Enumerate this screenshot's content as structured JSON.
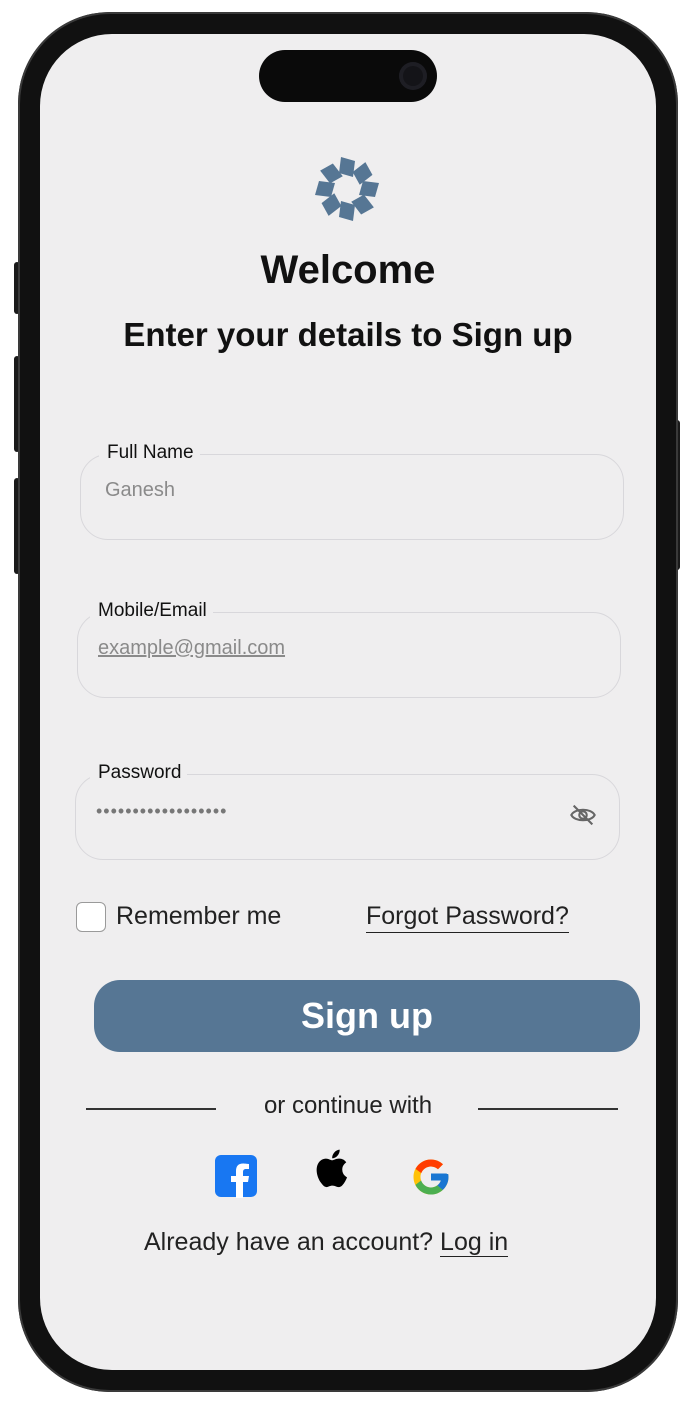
{
  "header": {
    "title": "Welcome",
    "subtitle": "Enter your details to Sign up"
  },
  "form": {
    "full_name": {
      "label": "Full Name",
      "placeholder": "Ganesh"
    },
    "contact": {
      "label": "Mobile/Email",
      "placeholder": "example@gmail.com"
    },
    "password": {
      "label": "Password",
      "value": "••••••••••••••••••"
    },
    "remember_label": "Remember me",
    "forgot_label": "Forgot Password?",
    "submit_label": "Sign up"
  },
  "social": {
    "divider_text": "or continue with",
    "providers": [
      "facebook-icon",
      "apple-icon",
      "google-icon"
    ]
  },
  "footer": {
    "prompt": "Already have an account?",
    "login_label": "Log in"
  },
  "colors": {
    "screen_bg": "#efeeef",
    "accent": "#567694",
    "facebook": "#1877f2"
  }
}
